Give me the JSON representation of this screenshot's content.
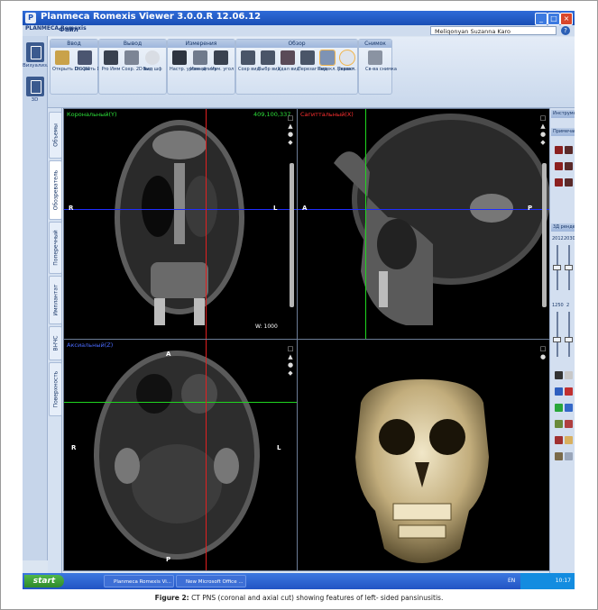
{
  "window": {
    "title": "Planmeca Romexis Viewer 3.0.0.R 12.06.12",
    "minimize": "_",
    "maximize": "□",
    "close": "×"
  },
  "menubar": {
    "brand": "PLANMECA Romexis",
    "file": "Файл",
    "user": "Meliqonyan Suzanna Karo",
    "help": "?"
  },
  "launcher": [
    {
      "label": "Визуализ..."
    },
    {
      "label": "3D"
    }
  ],
  "ribbon": {
    "groups": [
      {
        "title": "Ввод",
        "tools": [
          {
            "label": "Открыть DICOM"
          },
          {
            "label": "Открыть DICOMDIR"
          }
        ]
      },
      {
        "title": "Вывод",
        "tools": [
          {
            "label": "Pro Имм"
          },
          {
            "label": "Сохр. 2D вид"
          },
          {
            "label": "Вып шф"
          }
        ]
      },
      {
        "title": "Измерения",
        "tools": [
          {
            "label": "Настр. уровней"
          },
          {
            "label": "Изм. длину"
          },
          {
            "label": "Изм. угол"
          }
        ]
      },
      {
        "title": "Обзор",
        "tools": [
          {
            "label": "Сохр вид"
          },
          {
            "label": "Выбр вид"
          },
          {
            "label": "Удал вид"
          },
          {
            "label": "Перезаг вид"
          },
          {
            "label": "Перекл. указат."
          },
          {
            "label": "Перекл. масштаб"
          }
        ]
      },
      {
        "title": "Снимок",
        "tools": [
          {
            "label": "Св-ва снимка"
          }
        ]
      }
    ]
  },
  "sidetabs": [
    "Объемы",
    "Обозреватель",
    "Поперечный",
    "Имплантат",
    "ВНЧС",
    "Поверхность"
  ],
  "viewports": {
    "coronal": {
      "name": "Корональный(Y)",
      "coords": "409,100,337",
      "left": "R",
      "right": "L",
      "wl": "W: 1000"
    },
    "sagittal": {
      "name": "Сагиттальный(X)",
      "left": "A",
      "right": "P"
    },
    "axial": {
      "name": "Аксиальный(Z)",
      "top": "A",
      "bottom": "P",
      "left": "R",
      "right": "L"
    }
  },
  "right_panel": {
    "tools_title": "Инструмент",
    "notes_title": "Примечания",
    "render_title": "3Д рендер",
    "values": [
      "2012",
      "2030",
      "1250",
      "2"
    ]
  },
  "taskbar": {
    "start": "start",
    "tasks": [
      "Planmeca Romexis Vi...",
      "New Microsoft Office ..."
    ],
    "lang": "EN",
    "clock": "10:17"
  },
  "caption": {
    "label": "Figure 2:",
    "text": " CT PNS (coronal and axial cut) showing features of left- sided pansinusitis."
  },
  "colors": {
    "coronal_line": "#1f2dff",
    "sagittal_line": "#1fd61f",
    "crosshair_red": "#e02020",
    "coronal_label": "#2de03a",
    "sagittal_label": "#ff3030",
    "axial_label": "#4a6bff"
  }
}
